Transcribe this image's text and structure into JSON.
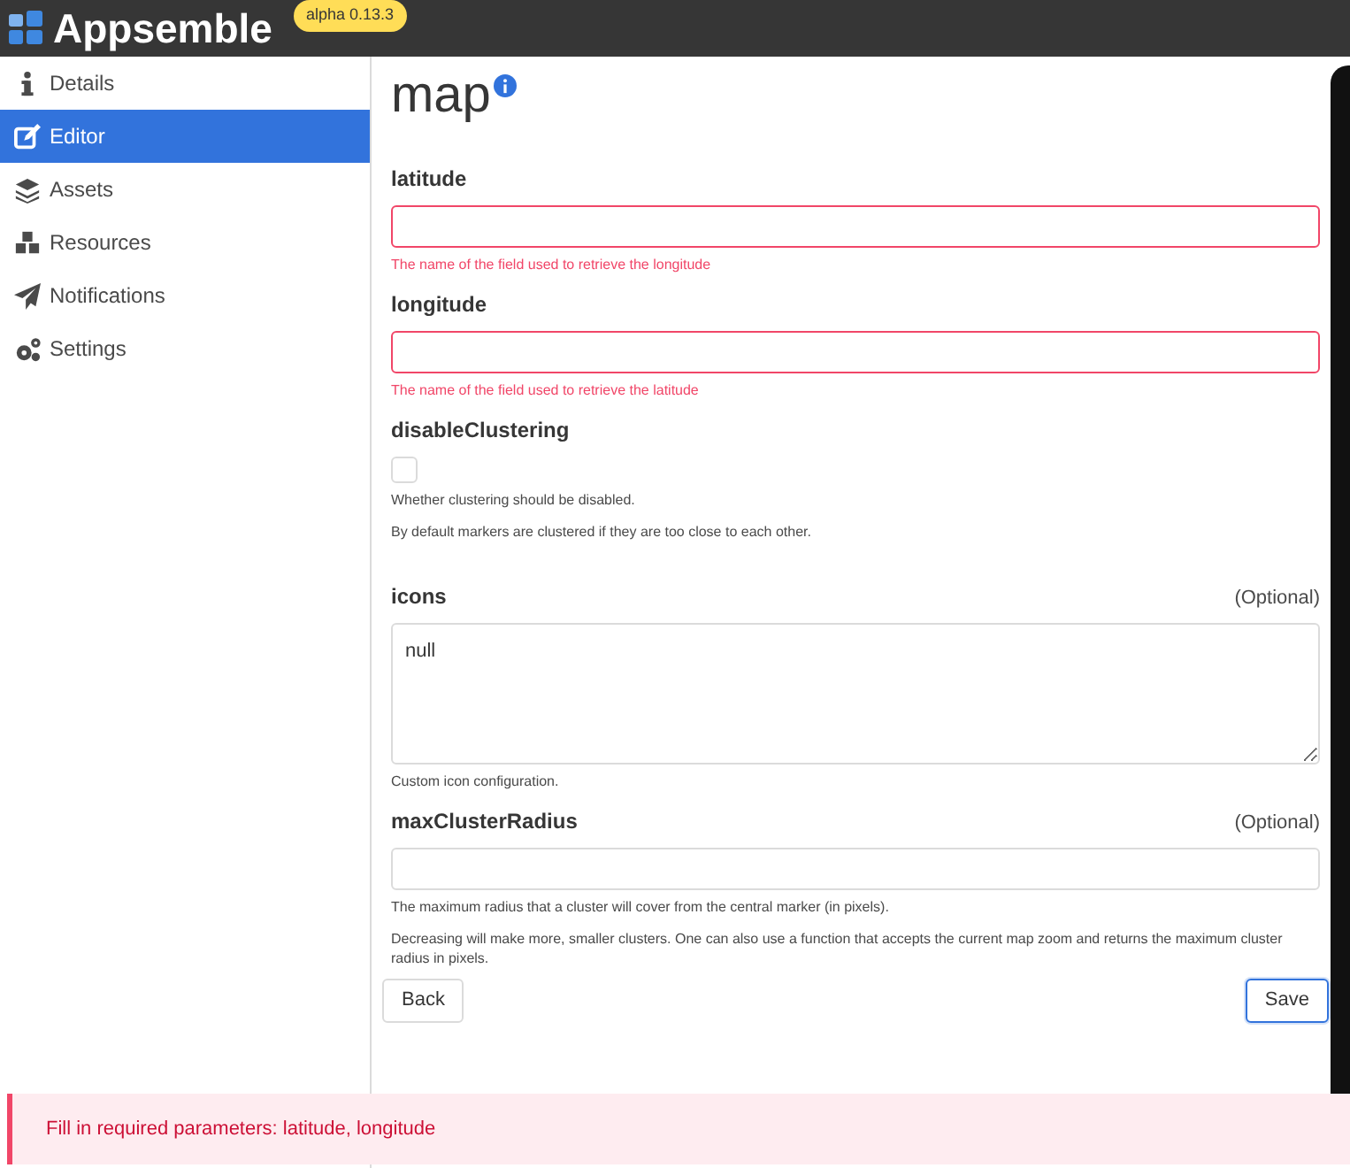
{
  "header": {
    "logo_text": "Appsemble",
    "version_badge": "alpha 0.13.3"
  },
  "sidebar": {
    "items": [
      {
        "label": "Details",
        "selected": false
      },
      {
        "label": "Editor",
        "selected": true
      },
      {
        "label": "Assets",
        "selected": false
      },
      {
        "label": "Resources",
        "selected": false
      },
      {
        "label": "Notifications",
        "selected": false
      },
      {
        "label": "Settings",
        "selected": false
      }
    ]
  },
  "form": {
    "title": "map",
    "fields": [
      {
        "kind": "text",
        "label": "latitude",
        "invalid": true,
        "descriptions": [
          "The name of the field used to retrieve the longitude"
        ]
      },
      {
        "kind": "text",
        "label": "longitude",
        "invalid": true,
        "descriptions": [
          "The name of the field used to retrieve the latitude"
        ]
      },
      {
        "kind": "checkbox",
        "label": "disableClustering",
        "checked": false,
        "descriptions": [
          "Whether clustering should be disabled.",
          "By default markers are clustered if they are too close to each other."
        ]
      },
      {
        "kind": "textarea",
        "label": "icons",
        "optional": "(Optional)",
        "value": "null",
        "descriptions": [
          "Custom icon configuration."
        ]
      },
      {
        "kind": "text",
        "label": "maxClusterRadius",
        "optional": "(Optional)",
        "invalid": false,
        "descriptions": [
          "The maximum radius that a cluster will cover from the central marker (in pixels).",
          "Decreasing will make more, smaller clusters. One can also use a function that accepts the current map zoom and returns the maximum cluster radius in pixels."
        ]
      }
    ],
    "buttons": [
      {
        "label": "Back",
        "primary": false
      },
      {
        "label": "Save",
        "primary": true
      }
    ]
  },
  "notification": {
    "message": "Fill in required parameters: latitude, longitude"
  }
}
